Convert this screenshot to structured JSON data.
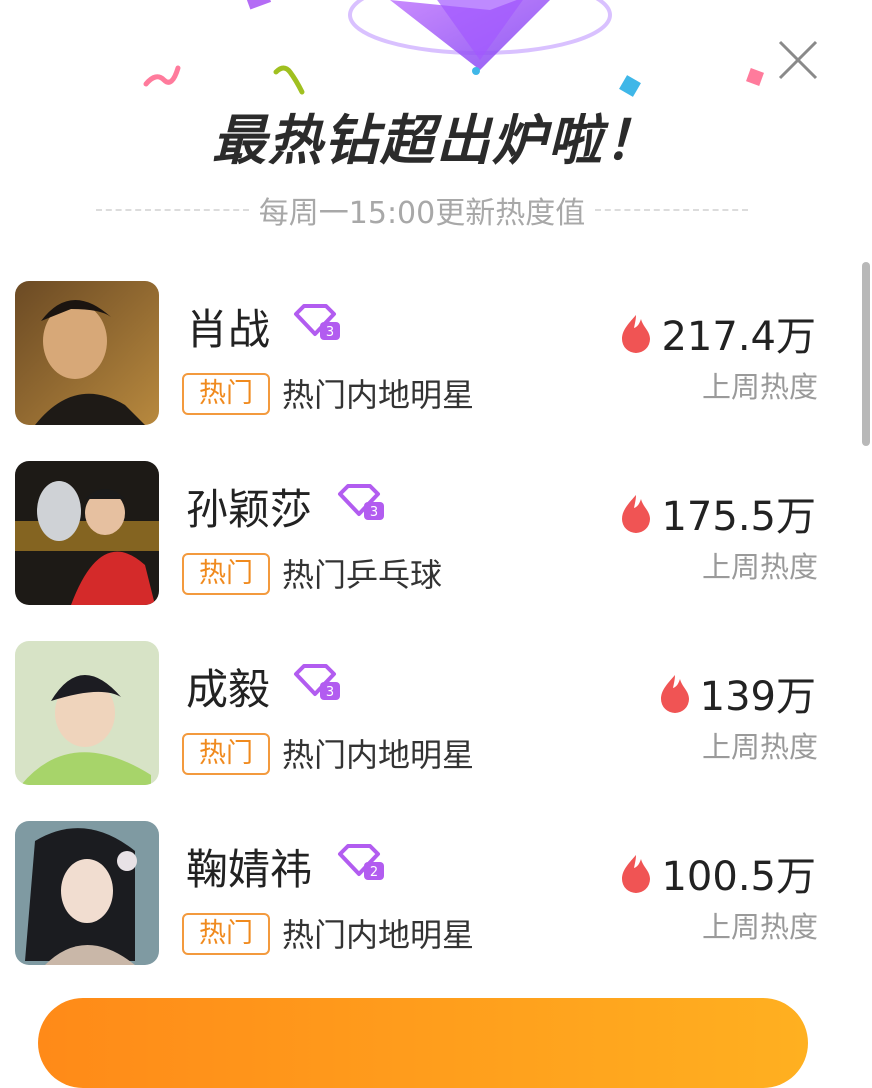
{
  "header": {
    "title": "最热钻超出炉啦！",
    "subtitle": "每周一15:00更新热度值"
  },
  "colors": {
    "accent": "#b25cf0",
    "tag": "#f39a3e",
    "flame": "#f05454",
    "button": "#ff9a18"
  },
  "items": [
    {
      "name": "肖战",
      "badge_icon": "diamond-level-3-icon",
      "tag": "热门",
      "category": "热门内地明星",
      "heat": "217.4万",
      "heat_label": "上周热度"
    },
    {
      "name": "孙颖莎",
      "badge_icon": "diamond-level-3-icon",
      "tag": "热门",
      "category": "热门乒乓球",
      "heat": "175.5万",
      "heat_label": "上周热度"
    },
    {
      "name": "成毅",
      "badge_icon": "diamond-level-3-icon",
      "tag": "热门",
      "category": "热门内地明星",
      "heat": "139万",
      "heat_label": "上周热度"
    },
    {
      "name": "鞠婧祎",
      "badge_icon": "diamond-level-2-icon",
      "tag": "热门",
      "category": "热门内地明星",
      "heat": "100.5万",
      "heat_label": "上周热度"
    }
  ]
}
